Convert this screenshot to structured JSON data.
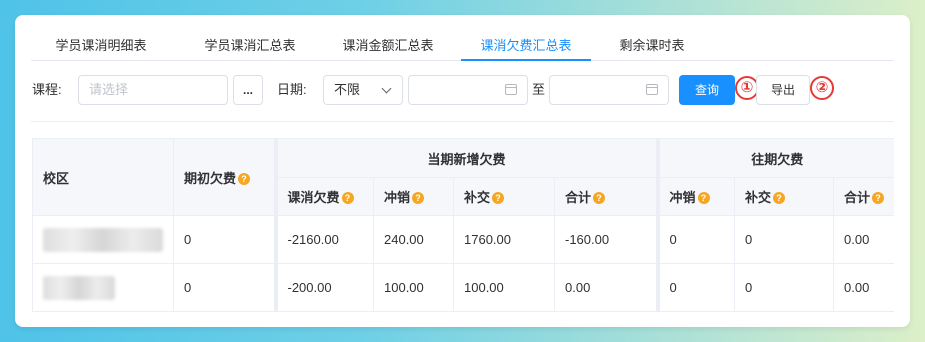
{
  "tabs": [
    {
      "label": "学员课消明细表",
      "active": false
    },
    {
      "label": "学员课消汇总表",
      "active": false
    },
    {
      "label": "课消金额汇总表",
      "active": false
    },
    {
      "label": "课消欠费汇总表",
      "active": true
    },
    {
      "label": "剩余课时表",
      "active": false
    }
  ],
  "filters": {
    "course_label": "课程:",
    "course_placeholder": "请选择",
    "more_label": "...",
    "date_label": "日期:",
    "date_mode": "不限",
    "range_sep": "至"
  },
  "buttons": {
    "query": "查询",
    "export": "导出"
  },
  "markers": {
    "one": "①",
    "two": "②"
  },
  "table": {
    "headers": {
      "campus": "校区",
      "opening_debt": "期初欠费",
      "current_group": "当期新增欠费",
      "consume_debt": "课消欠费",
      "offset": "冲销",
      "repay": "补交",
      "total": "合计",
      "past_group": "往期欠费",
      "past_offset": "冲销",
      "past_repay": "补交",
      "past_total": "合计"
    },
    "rows": [
      {
        "opening": "0",
        "consume": "-2160.00",
        "offset": "240.00",
        "repay": "1760.00",
        "total": "-160.00",
        "past_offset": "0",
        "past_repay": "0",
        "past_total": "0.00"
      },
      {
        "opening": "0",
        "consume": "-200.00",
        "offset": "100.00",
        "repay": "100.00",
        "total": "0.00",
        "past_offset": "0",
        "past_repay": "0",
        "past_total": "0.00"
      }
    ]
  },
  "colors": {
    "accent": "#1890ff",
    "marker": "#e53935",
    "help_icon": "#f5a623"
  }
}
